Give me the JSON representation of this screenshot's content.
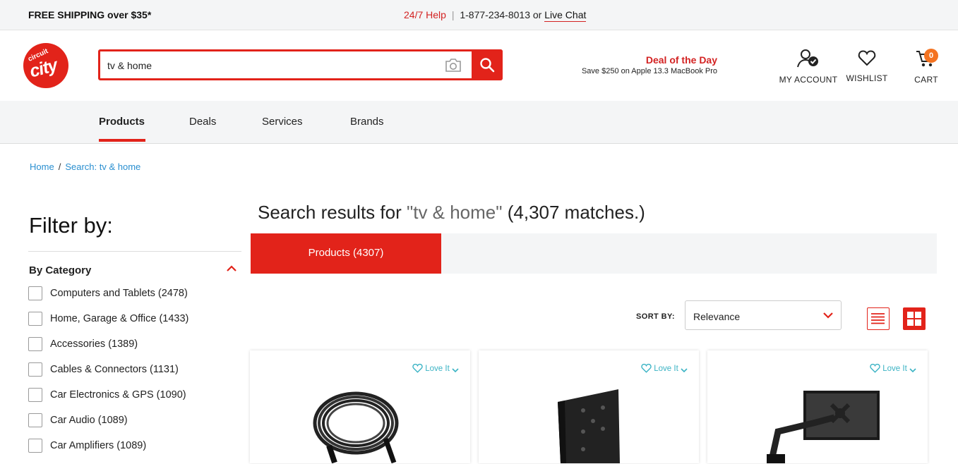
{
  "topbar": {
    "shipping": "FREE SHIPPING over $35*",
    "help_label": "24/7 Help",
    "separator": "|",
    "phone": "1-877-234-8013",
    "or": "or",
    "live_chat": "Live Chat"
  },
  "logo": {
    "line1": "circuit",
    "line2": "city"
  },
  "search": {
    "value": "tv & home",
    "placeholder": ""
  },
  "deal": {
    "title": "Deal of the Day",
    "subtitle": "Save $250 on Apple 13.3 MacBook Pro"
  },
  "header_icons": {
    "account": "MY ACCOUNT",
    "wishlist": "WISHLIST",
    "cart": "CART",
    "cart_count": "0"
  },
  "nav": {
    "items": [
      "Products",
      "Deals",
      "Services",
      "Brands"
    ],
    "active": "Products"
  },
  "breadcrumb": {
    "home": "Home",
    "separator": "/",
    "current": "Search: tv & home"
  },
  "filter": {
    "title": "Filter by:",
    "category_title": "By Category",
    "categories": [
      "Computers and Tablets (2478)",
      "Home, Garage & Office (1433)",
      "Accessories (1389)",
      "Cables & Connectors (1131)",
      "Car Electronics & GPS (1090)",
      "Car Audio (1089)",
      "Car Amplifiers (1089)"
    ]
  },
  "results": {
    "prefix": "Search results for",
    "query": "\"tv & home\"",
    "count": "(4,307 matches.)",
    "tab_active": "Products (4307)"
  },
  "sort": {
    "label": "SORT BY:",
    "value": "Relevance"
  },
  "products": [
    {
      "love": "Love It"
    },
    {
      "love": "Love It"
    },
    {
      "love": "Love It"
    }
  ],
  "colors": {
    "brand_red": "#e2231a",
    "accent_teal": "#3ab3c4",
    "badge_orange": "#f47321"
  }
}
